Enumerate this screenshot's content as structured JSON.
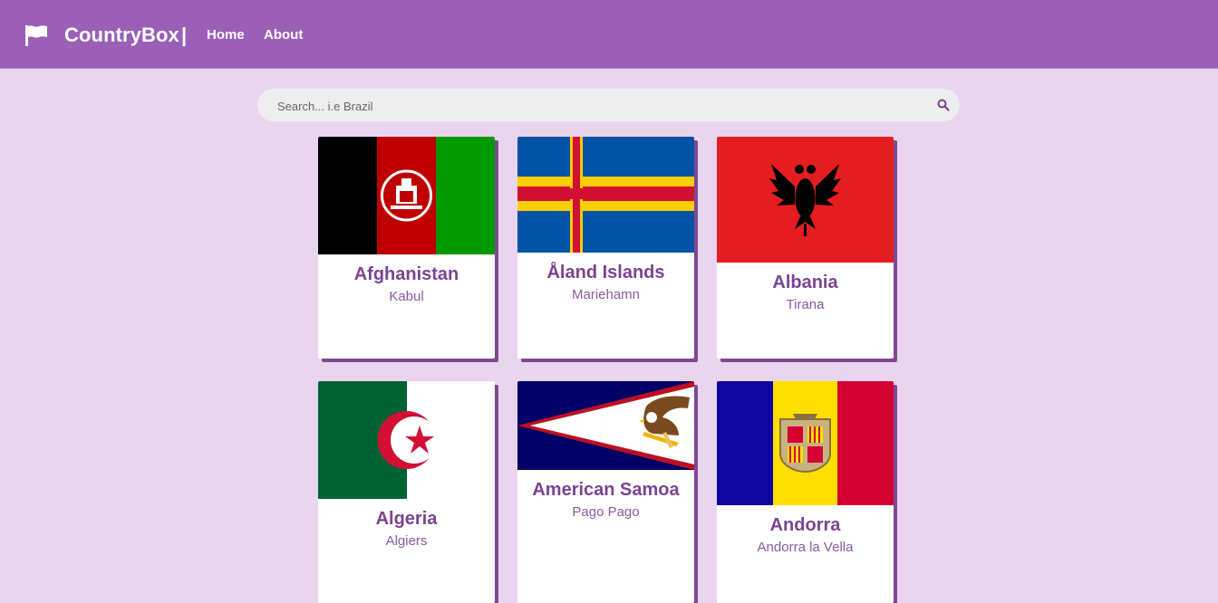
{
  "navbar": {
    "brand": "CountryBox",
    "separator": "|",
    "links": {
      "home": "Home",
      "about": "About"
    },
    "brand_icon": "flag-icon",
    "color": "#9b5fb6"
  },
  "search": {
    "placeholder": "Search... i.e Brazil",
    "value": "",
    "icon": "search-icon"
  },
  "countries": [
    {
      "name": "Afghanistan",
      "capital": "Kabul"
    },
    {
      "name": "Åland Islands",
      "capital": "Mariehamn"
    },
    {
      "name": "Albania",
      "capital": "Tirana"
    },
    {
      "name": "Algeria",
      "capital": "Algiers"
    },
    {
      "name": "American Samoa",
      "capital": "Pago Pago"
    },
    {
      "name": "Andorra",
      "capital": "Andorra la Vella"
    }
  ],
  "colors": {
    "background": "#ead5ef",
    "accent": "#7a4491",
    "card": "#ffffff"
  }
}
